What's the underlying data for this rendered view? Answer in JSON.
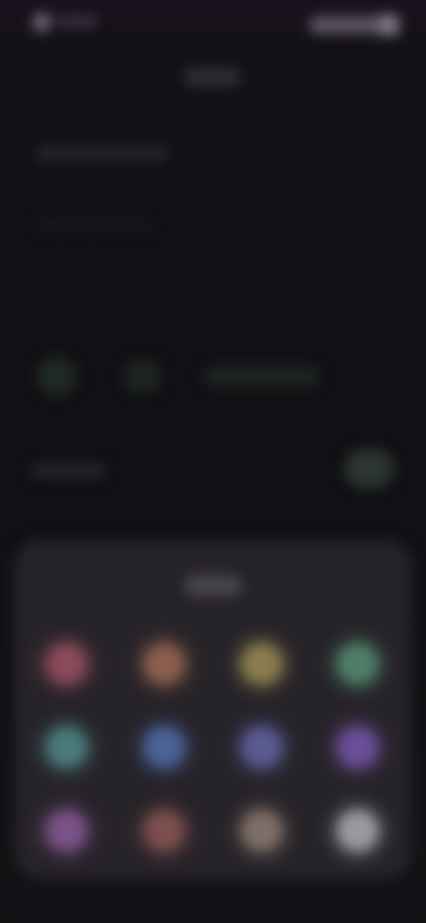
{
  "status_bar": {
    "time": "",
    "status_icons": [
      "status-icon"
    ]
  },
  "header": {
    "title": "",
    "subtitle": ""
  },
  "settings_row": {
    "label": ""
  },
  "color_sheet": {
    "title": "",
    "colors": [
      {
        "name": "red",
        "hex": "#8a4a5a"
      },
      {
        "name": "orange",
        "hex": "#8a5e4c"
      },
      {
        "name": "yellow",
        "hex": "#8a7c4e"
      },
      {
        "name": "green",
        "hex": "#4e7e68"
      },
      {
        "name": "teal",
        "hex": "#4a7a7c"
      },
      {
        "name": "blue",
        "hex": "#4a6296"
      },
      {
        "name": "indigo",
        "hex": "#5a5a92"
      },
      {
        "name": "purple",
        "hex": "#6a4e96"
      },
      {
        "name": "magenta",
        "hex": "#7a5286"
      },
      {
        "name": "coral",
        "hex": "#7c4e4e"
      },
      {
        "name": "sand",
        "hex": "#7e6e66"
      },
      {
        "name": "white",
        "hex": "#9a9a9e"
      }
    ]
  }
}
